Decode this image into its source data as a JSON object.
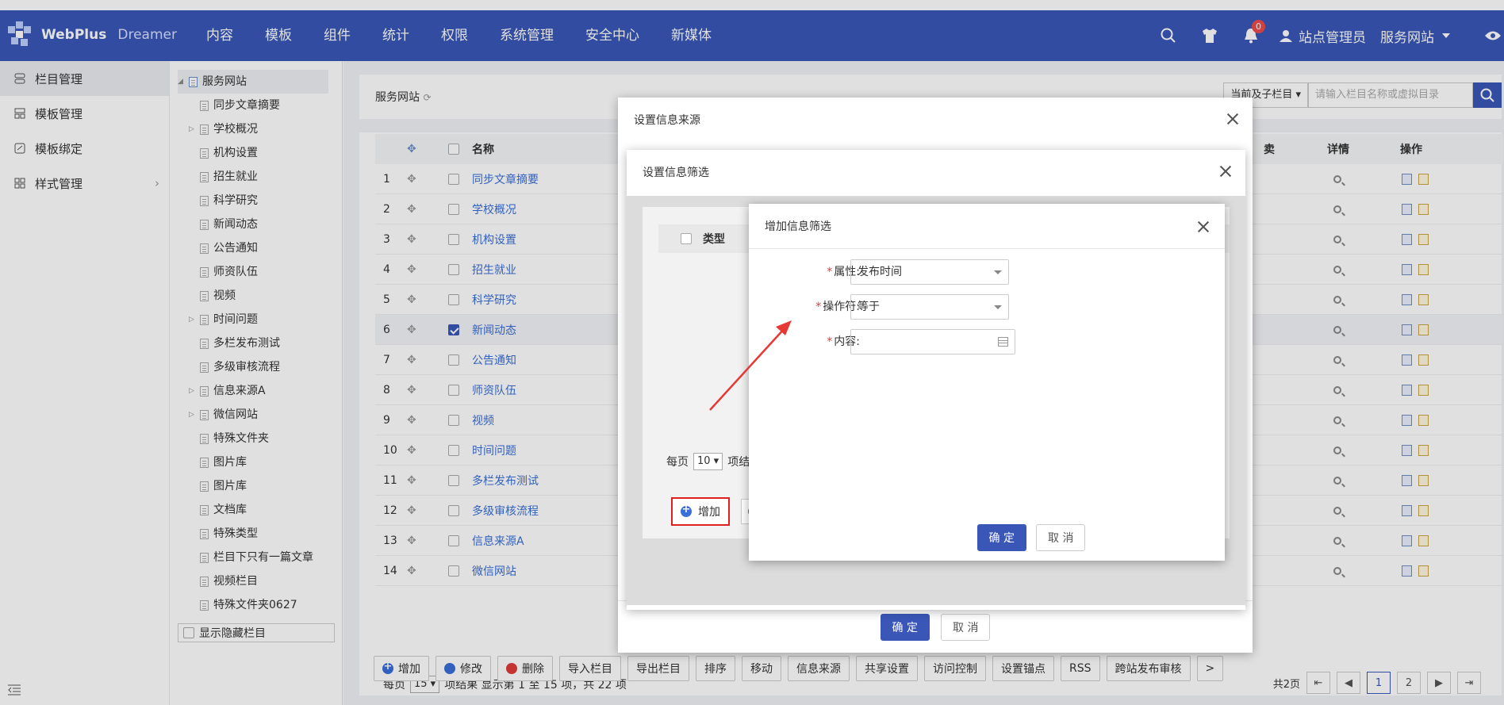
{
  "topbar": {
    "logo_bold": "WebPlus",
    "logo_light": "Dreamer",
    "nav": [
      "内容",
      "模板",
      "组件",
      "统计",
      "权限",
      "系统管理",
      "安全中心",
      "新媒体"
    ],
    "notification_count": "0",
    "user": "站点管理员",
    "site": "服务网站",
    "color": "#3a57b8"
  },
  "sidebar": {
    "items": [
      {
        "label": "栏目管理",
        "icon": "columns-icon"
      },
      {
        "label": "模板管理",
        "icon": "template-icon"
      },
      {
        "label": "模板绑定",
        "icon": "bind-icon"
      },
      {
        "label": "样式管理",
        "icon": "style-icon"
      }
    ]
  },
  "tree": {
    "root": "服务网站",
    "nodes": [
      {
        "label": "同步文章摘要",
        "expandable": false
      },
      {
        "label": "学校概况",
        "expandable": true
      },
      {
        "label": "机构设置",
        "expandable": false
      },
      {
        "label": "招生就业",
        "expandable": false
      },
      {
        "label": "科学研究",
        "expandable": false
      },
      {
        "label": "新闻动态",
        "expandable": false
      },
      {
        "label": "公告通知",
        "expandable": false
      },
      {
        "label": "师资队伍",
        "expandable": false
      },
      {
        "label": "视频",
        "expandable": false
      },
      {
        "label": "时间问题",
        "expandable": true
      },
      {
        "label": "多栏发布测试",
        "expandable": false
      },
      {
        "label": "多级审核流程",
        "expandable": false
      },
      {
        "label": "信息来源A",
        "expandable": true
      },
      {
        "label": "微信网站",
        "expandable": true
      },
      {
        "label": "特殊文件夹",
        "expandable": false
      },
      {
        "label": "图片库",
        "expandable": false
      },
      {
        "label": "图片库",
        "expandable": false
      },
      {
        "label": "文档库",
        "expandable": false
      },
      {
        "label": "特殊类型",
        "expandable": false
      },
      {
        "label": "栏目下只有一篇文章",
        "expandable": false
      },
      {
        "label": "视频栏目",
        "expandable": false
      },
      {
        "label": "特殊文件夹0627",
        "expandable": false
      }
    ],
    "show_hidden": "显示隐藏栏目"
  },
  "main": {
    "title": "服务网站",
    "scope": "当前及子栏目",
    "search_placeholder": "请输入栏目名称或虚拟目录",
    "headers": {
      "name": "名称",
      "partial": "卖",
      "detail": "详情",
      "ops": "操作"
    },
    "rows": [
      {
        "n": "1",
        "name": "同步文章摘要",
        "checked": false
      },
      {
        "n": "2",
        "name": "学校概况",
        "checked": false
      },
      {
        "n": "3",
        "name": "机构设置",
        "checked": false
      },
      {
        "n": "4",
        "name": "招生就业",
        "checked": false
      },
      {
        "n": "5",
        "name": "科学研究",
        "checked": false
      },
      {
        "n": "6",
        "name": "新闻动态",
        "checked": true
      },
      {
        "n": "7",
        "name": "公告通知",
        "checked": false
      },
      {
        "n": "8",
        "name": "师资队伍",
        "checked": false
      },
      {
        "n": "9",
        "name": "视频",
        "checked": false
      },
      {
        "n": "10",
        "name": "时间问题",
        "checked": false
      },
      {
        "n": "11",
        "name": "多栏发布测试",
        "checked": false
      },
      {
        "n": "12",
        "name": "多级审核流程",
        "checked": false
      },
      {
        "n": "13",
        "name": "信息来源A",
        "checked": false
      },
      {
        "n": "14",
        "name": "微信网站",
        "checked": false
      }
    ],
    "pager": {
      "per_page_label": "每页",
      "per_page": "15",
      "summary": "项结果 显示第 1 至 15 项，共 22 项",
      "total_pages": "共2页",
      "pages": [
        "1",
        "2"
      ]
    },
    "toolbar": [
      "增加",
      "修改",
      "删除",
      "导入栏目",
      "导出栏目",
      "排序",
      "移动",
      "信息来源",
      "共享设置",
      "访问控制",
      "设置锚点",
      "RSS",
      "跨站发布审核",
      ">"
    ]
  },
  "dialog_source": {
    "title": "设置信息来源",
    "ok": "确 定",
    "cancel": "取 消"
  },
  "dialog_filter": {
    "title": "设置信息筛选",
    "type_header": "类型",
    "per_page_label": "每页",
    "per_page": "10",
    "per_page_suffix": "项结",
    "add": "增加"
  },
  "dialog_add": {
    "title": "增加信息筛选",
    "fields": [
      {
        "label": "属性:",
        "value": "发布时间"
      },
      {
        "label": "操作符:",
        "value": "等于"
      },
      {
        "label": "内容:",
        "value": ""
      }
    ],
    "ok": "确 定",
    "cancel": "取 消"
  }
}
